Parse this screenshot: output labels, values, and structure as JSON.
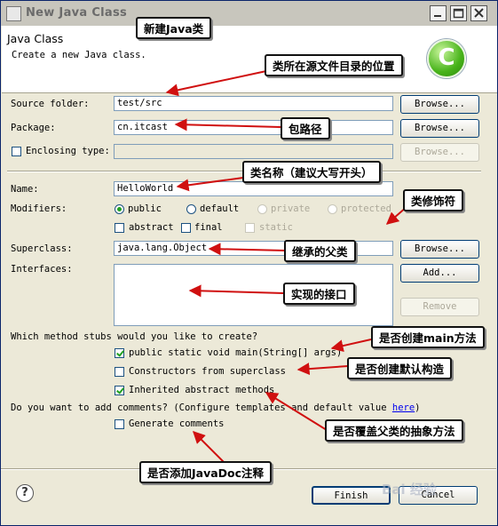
{
  "window": {
    "title": "New Java Class"
  },
  "header": {
    "title": "Java Class",
    "description": "Create a new Java class."
  },
  "form": {
    "source_folder": {
      "label": "Source folder:",
      "value": "test/src",
      "browse": "Browse..."
    },
    "package": {
      "label": "Package:",
      "value": "cn.itcast",
      "browse": "Browse..."
    },
    "enclosing": {
      "label": "Enclosing type:",
      "value": "",
      "browse": "Browse..."
    },
    "name": {
      "label": "Name:",
      "value": "HelloWorld"
    },
    "modifiers": {
      "label": "Modifiers:",
      "public": "public",
      "default": "default",
      "private": "private",
      "protected": "protected",
      "abstract": "abstract",
      "final": "final",
      "static": "static"
    },
    "superclass": {
      "label": "Superclass:",
      "value": "java.lang.Object",
      "browse": "Browse..."
    },
    "interfaces": {
      "label": "Interfaces:",
      "add": "Add...",
      "remove": "Remove"
    },
    "stubs": {
      "question": "Which method stubs would you like to create?",
      "main": "public static void main(String[] args)",
      "constructors": "Constructors from superclass",
      "inherited": "Inherited abstract methods"
    },
    "comments": {
      "question_prefix": "Do you want to add comments? (Configure templates and default value ",
      "link": "here",
      "question_suffix": ")",
      "generate": "Generate comments"
    }
  },
  "footer": {
    "finish": "Finish",
    "cancel": "Cancel"
  },
  "annotations": {
    "new_class": "新建Java类",
    "source_dir": "类所在源文件目录的位置",
    "package_path": "包路径",
    "class_name": "类名称（建议大写开头）",
    "modifier": "类修饰符",
    "superclass": "继承的父类",
    "interfaces": "实现的接口",
    "main_method": "是否创建main方法",
    "default_ctor": "是否创建默认构造",
    "override_abstract": "是否覆盖父类的抽象方法",
    "javadoc": "是否添加JavaDoc注释"
  },
  "watermark": "Bai 经验",
  "colors": {
    "accent_green": "#21a121",
    "annotation_arrow": "#d01010"
  }
}
